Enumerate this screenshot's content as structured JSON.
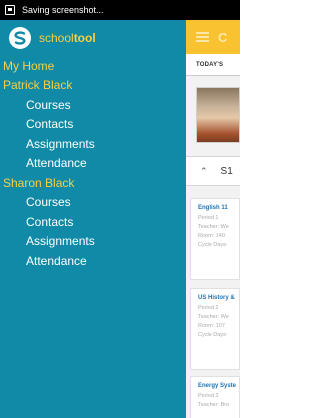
{
  "status_bar": {
    "notification_text": "Saving screenshot..."
  },
  "drawer": {
    "logo": {
      "text_light": "school",
      "text_bold": "tool"
    },
    "items": [
      {
        "label": "My Home",
        "type": "accent"
      },
      {
        "label": "Patrick Black",
        "type": "accent"
      },
      {
        "label": "Courses",
        "type": "sub"
      },
      {
        "label": "Contacts",
        "type": "sub"
      },
      {
        "label": "Assignments",
        "type": "sub"
      },
      {
        "label": "Attendance",
        "type": "sub"
      },
      {
        "label": "Sharon Black",
        "type": "accent"
      },
      {
        "label": "Courses",
        "type": "sub"
      },
      {
        "label": "Contacts",
        "type": "sub"
      },
      {
        "label": "Assignments",
        "type": "sub"
      },
      {
        "label": "Attendance",
        "type": "sub"
      }
    ]
  },
  "background": {
    "header_title": "C",
    "tab_label": "TODAY'S",
    "semester_label": "S1",
    "courses": [
      {
        "title": "English 11",
        "lines": [
          "Period 1",
          "Teacher: We",
          "Room: 140",
          "Cycle Days: "
        ]
      },
      {
        "title": "US History &",
        "lines": [
          "Period 2",
          "Teacher: We",
          "Room: 107",
          "Cycle Days: "
        ]
      },
      {
        "title": "Energy Syste",
        "lines": [
          "Period 3",
          "Teacher: Bro"
        ]
      }
    ]
  },
  "colors": {
    "drawer_background": "#108aa6",
    "accent_yellow": "#f7d046",
    "app_header": "#f9c230",
    "course_title_blue": "#1a73b8"
  }
}
